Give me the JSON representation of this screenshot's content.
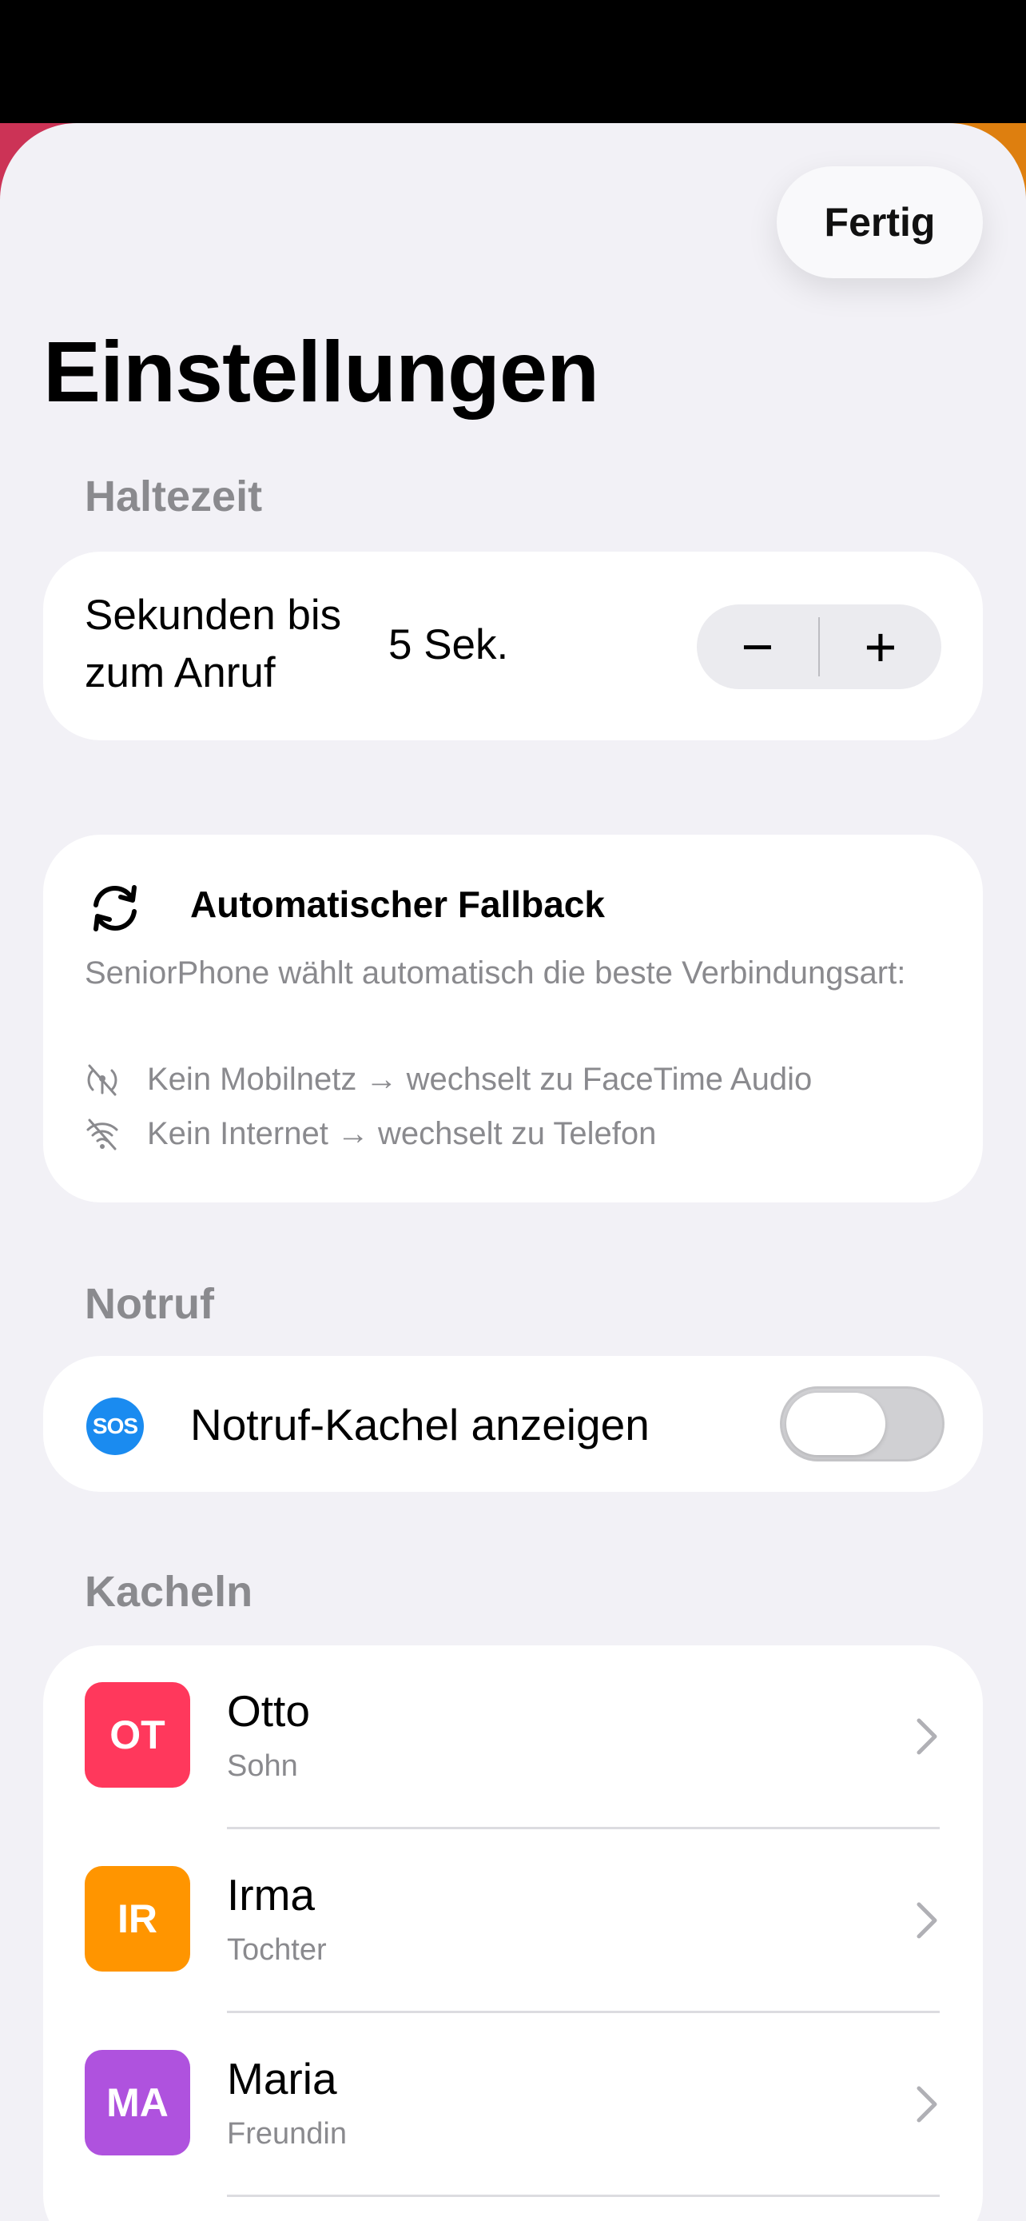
{
  "header": {
    "done_label": "Fertig",
    "title": "Einstellungen"
  },
  "hold_time": {
    "section_title": "Haltezeit",
    "label": "Sekunden bis zum Anruf",
    "value": "5 Sek.",
    "decrement_symbol": "−",
    "increment_symbol": "+"
  },
  "fallback": {
    "icon": "refresh-icon",
    "title": "Automatischer Fallback",
    "description": "SeniorPhone wählt automatisch die beste Verbindungsart:",
    "rules": [
      {
        "icon": "no-signal-icon",
        "text": "Kein Mobilnetz → wechselt zu FaceTime Audio"
      },
      {
        "icon": "no-wifi-icon",
        "text": "Kein Internet → wechselt zu Telefon"
      }
    ]
  },
  "emergency": {
    "section_title": "Notruf",
    "icon_text": "SOS",
    "label": "Notruf-Kachel anzeigen",
    "enabled": false
  },
  "tiles": {
    "section_title": "Kacheln",
    "items": [
      {
        "initials": "OT",
        "name": "Otto",
        "role": "Sohn",
        "color": "#ff385c"
      },
      {
        "initials": "IR",
        "name": "Irma",
        "role": "Tochter",
        "color": "#ff9500"
      },
      {
        "initials": "MA",
        "name": "Maria",
        "role": "Freundin",
        "color": "#af52de"
      }
    ]
  },
  "colors": {
    "accent_blue": "#1a8bf0",
    "background": "#f2f1f6",
    "secondary_text": "#8a8a8e"
  }
}
